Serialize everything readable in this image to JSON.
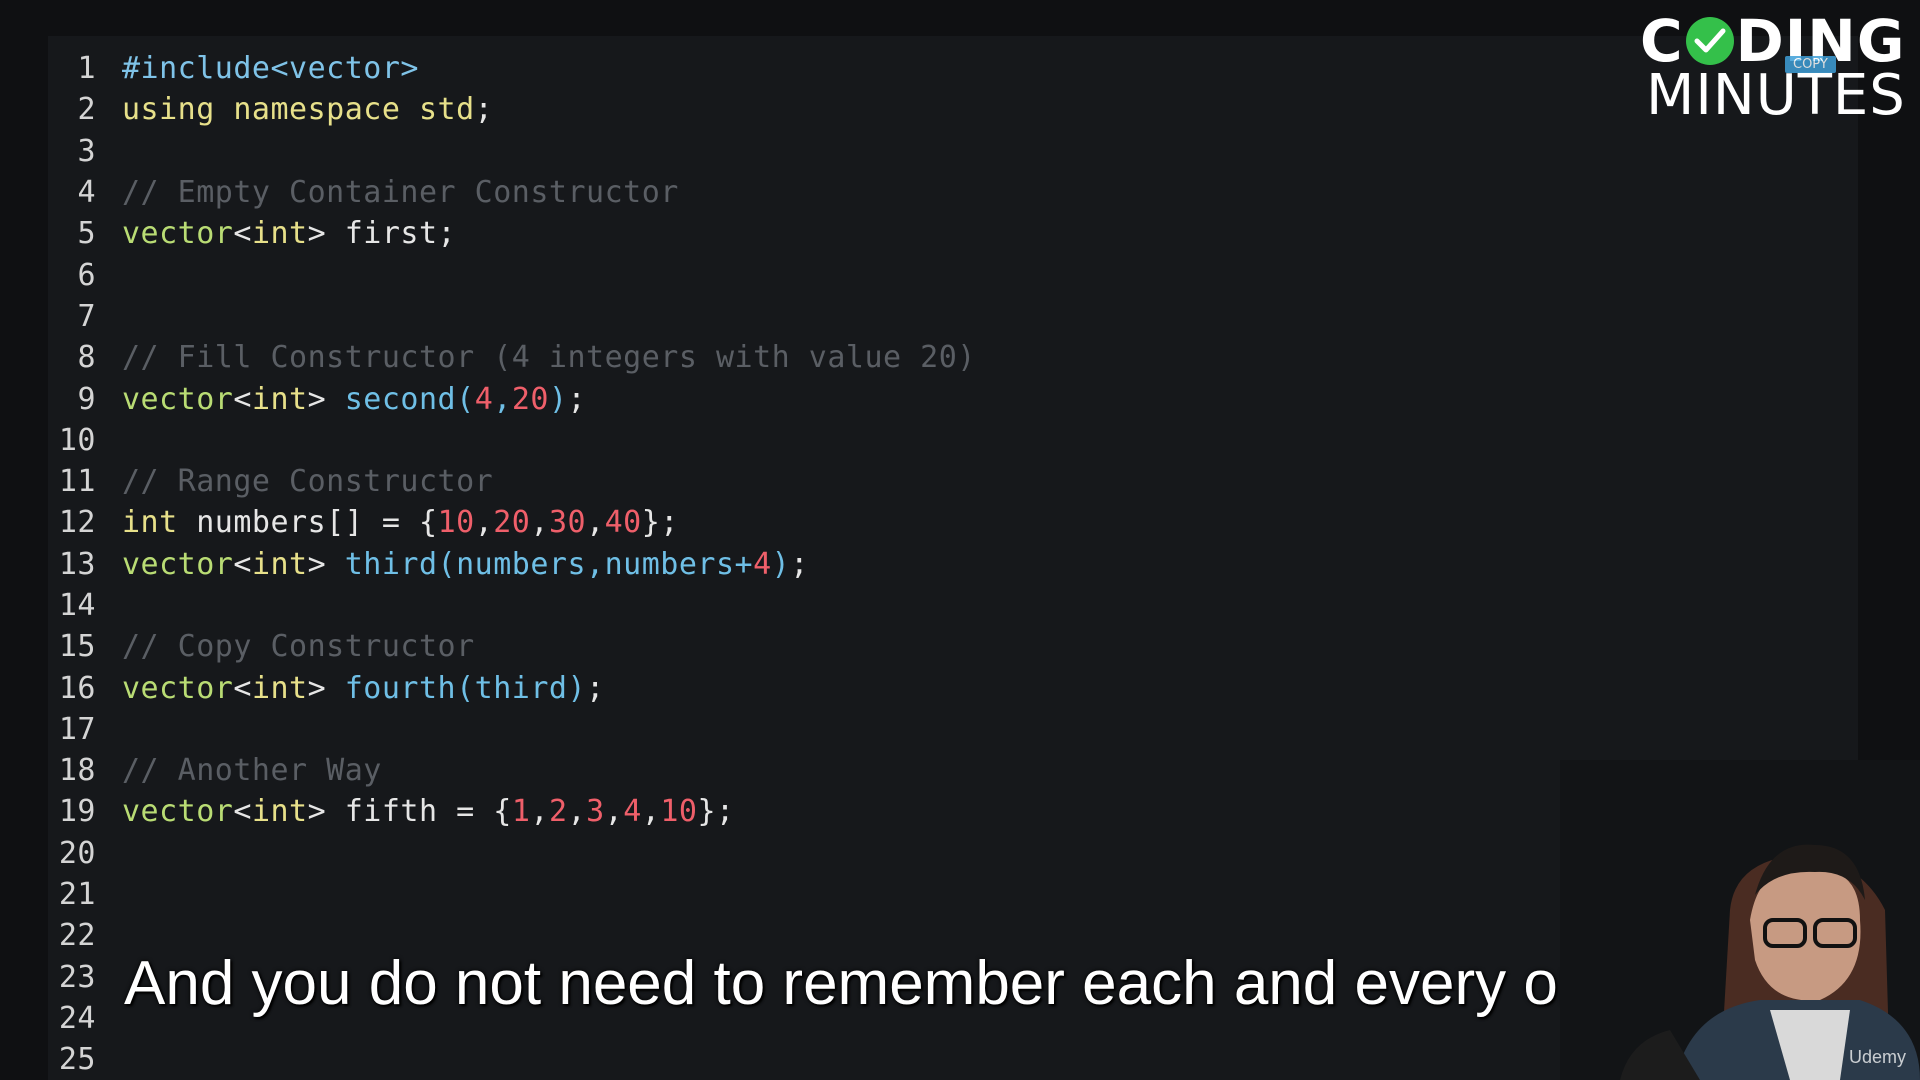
{
  "editor": {
    "lines": [
      {
        "n": "1",
        "tokens": [
          {
            "t": "#include<vector>",
            "c": "pre"
          }
        ]
      },
      {
        "n": "2",
        "tokens": [
          {
            "t": "using namespace std",
            "c": "kw"
          },
          {
            "t": ";",
            "c": "plain"
          }
        ]
      },
      {
        "n": "3",
        "tokens": []
      },
      {
        "n": "4",
        "tokens": [
          {
            "t": "// Empty Container Constructor",
            "c": "cmt"
          }
        ]
      },
      {
        "n": "5",
        "tokens": [
          {
            "t": "vector",
            "c": "type"
          },
          {
            "t": "<",
            "c": "plain"
          },
          {
            "t": "int",
            "c": "kw"
          },
          {
            "t": "> first;",
            "c": "plain"
          }
        ]
      },
      {
        "n": "6",
        "tokens": []
      },
      {
        "n": "7",
        "tokens": []
      },
      {
        "n": "8",
        "tokens": [
          {
            "t": "// Fill Constructor (4 integers with value 20)",
            "c": "cmt"
          }
        ]
      },
      {
        "n": "9",
        "tokens": [
          {
            "t": "vector",
            "c": "type"
          },
          {
            "t": "<",
            "c": "plain"
          },
          {
            "t": "int",
            "c": "kw"
          },
          {
            "t": "> ",
            "c": "plain"
          },
          {
            "t": "second(",
            "c": "fn"
          },
          {
            "t": "4",
            "c": "num"
          },
          {
            "t": ",",
            "c": "fn"
          },
          {
            "t": "20",
            "c": "num"
          },
          {
            "t": ")",
            "c": "fn"
          },
          {
            "t": ";",
            "c": "plain"
          }
        ]
      },
      {
        "n": "10",
        "tokens": []
      },
      {
        "n": "11",
        "tokens": [
          {
            "t": "// Range Constructor",
            "c": "cmt"
          }
        ]
      },
      {
        "n": "12",
        "tokens": [
          {
            "t": "int",
            "c": "kw"
          },
          {
            "t": " numbers[] = {",
            "c": "plain"
          },
          {
            "t": "10",
            "c": "num"
          },
          {
            "t": ",",
            "c": "plain"
          },
          {
            "t": "20",
            "c": "num"
          },
          {
            "t": ",",
            "c": "plain"
          },
          {
            "t": "30",
            "c": "num"
          },
          {
            "t": ",",
            "c": "plain"
          },
          {
            "t": "40",
            "c": "num"
          },
          {
            "t": "};",
            "c": "plain"
          }
        ]
      },
      {
        "n": "13",
        "tokens": [
          {
            "t": "vector",
            "c": "type"
          },
          {
            "t": "<",
            "c": "plain"
          },
          {
            "t": "int",
            "c": "kw"
          },
          {
            "t": "> ",
            "c": "plain"
          },
          {
            "t": "third(numbers,numbers+",
            "c": "fn"
          },
          {
            "t": "4",
            "c": "num"
          },
          {
            "t": ")",
            "c": "fn"
          },
          {
            "t": ";",
            "c": "plain"
          }
        ]
      },
      {
        "n": "14",
        "tokens": []
      },
      {
        "n": "15",
        "tokens": [
          {
            "t": "// Copy Constructor",
            "c": "cmt"
          }
        ]
      },
      {
        "n": "16",
        "tokens": [
          {
            "t": "vector",
            "c": "type"
          },
          {
            "t": "<",
            "c": "plain"
          },
          {
            "t": "int",
            "c": "kw"
          },
          {
            "t": "> ",
            "c": "plain"
          },
          {
            "t": "fourth(third)",
            "c": "fn"
          },
          {
            "t": ";",
            "c": "plain"
          }
        ]
      },
      {
        "n": "17",
        "tokens": []
      },
      {
        "n": "18",
        "tokens": [
          {
            "t": "// Another Way",
            "c": "cmt"
          }
        ]
      },
      {
        "n": "19",
        "tokens": [
          {
            "t": "vector",
            "c": "type"
          },
          {
            "t": "<",
            "c": "plain"
          },
          {
            "t": "int",
            "c": "kw"
          },
          {
            "t": "> fifth = {",
            "c": "plain"
          },
          {
            "t": "1",
            "c": "num"
          },
          {
            "t": ",",
            "c": "plain"
          },
          {
            "t": "2",
            "c": "num"
          },
          {
            "t": ",",
            "c": "plain"
          },
          {
            "t": "3",
            "c": "num"
          },
          {
            "t": ",",
            "c": "plain"
          },
          {
            "t": "4",
            "c": "num"
          },
          {
            "t": ",",
            "c": "plain"
          },
          {
            "t": "10",
            "c": "num"
          },
          {
            "t": "};",
            "c": "plain"
          }
        ]
      },
      {
        "n": "20",
        "tokens": []
      },
      {
        "n": "21",
        "tokens": []
      },
      {
        "n": "22",
        "tokens": []
      },
      {
        "n": "23",
        "tokens": []
      },
      {
        "n": "24",
        "tokens": []
      },
      {
        "n": "25",
        "tokens": []
      }
    ]
  },
  "logo": {
    "row1_a": "C",
    "row1_b": "DING",
    "row2": "MINUTES",
    "tag": "COPY"
  },
  "caption": "And you do not need to remember each and every one.",
  "watermark": "Udemy",
  "colors": {
    "background": "#0f1012",
    "editor_bg": "#16181b",
    "comment": "#5a5e64",
    "keyword": "#e7e08a",
    "type": "#b9dc74",
    "function": "#6fbfe6",
    "number": "#ef5f6a",
    "logo_check": "#34c04a"
  }
}
